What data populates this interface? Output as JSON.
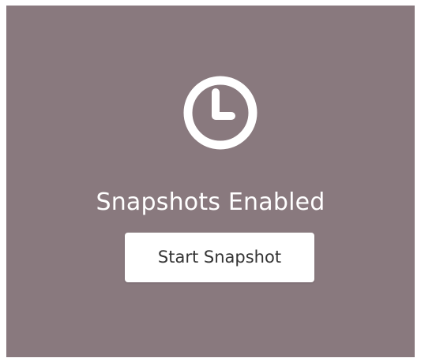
{
  "snapshot_panel": {
    "icon": "clock-icon",
    "status_title": "Snapshots Enabled",
    "start_button_label": "Start Snapshot",
    "colors": {
      "panel_background": "#89797e",
      "foreground": "#ffffff",
      "button_background": "#ffffff",
      "button_text": "#333333"
    }
  }
}
